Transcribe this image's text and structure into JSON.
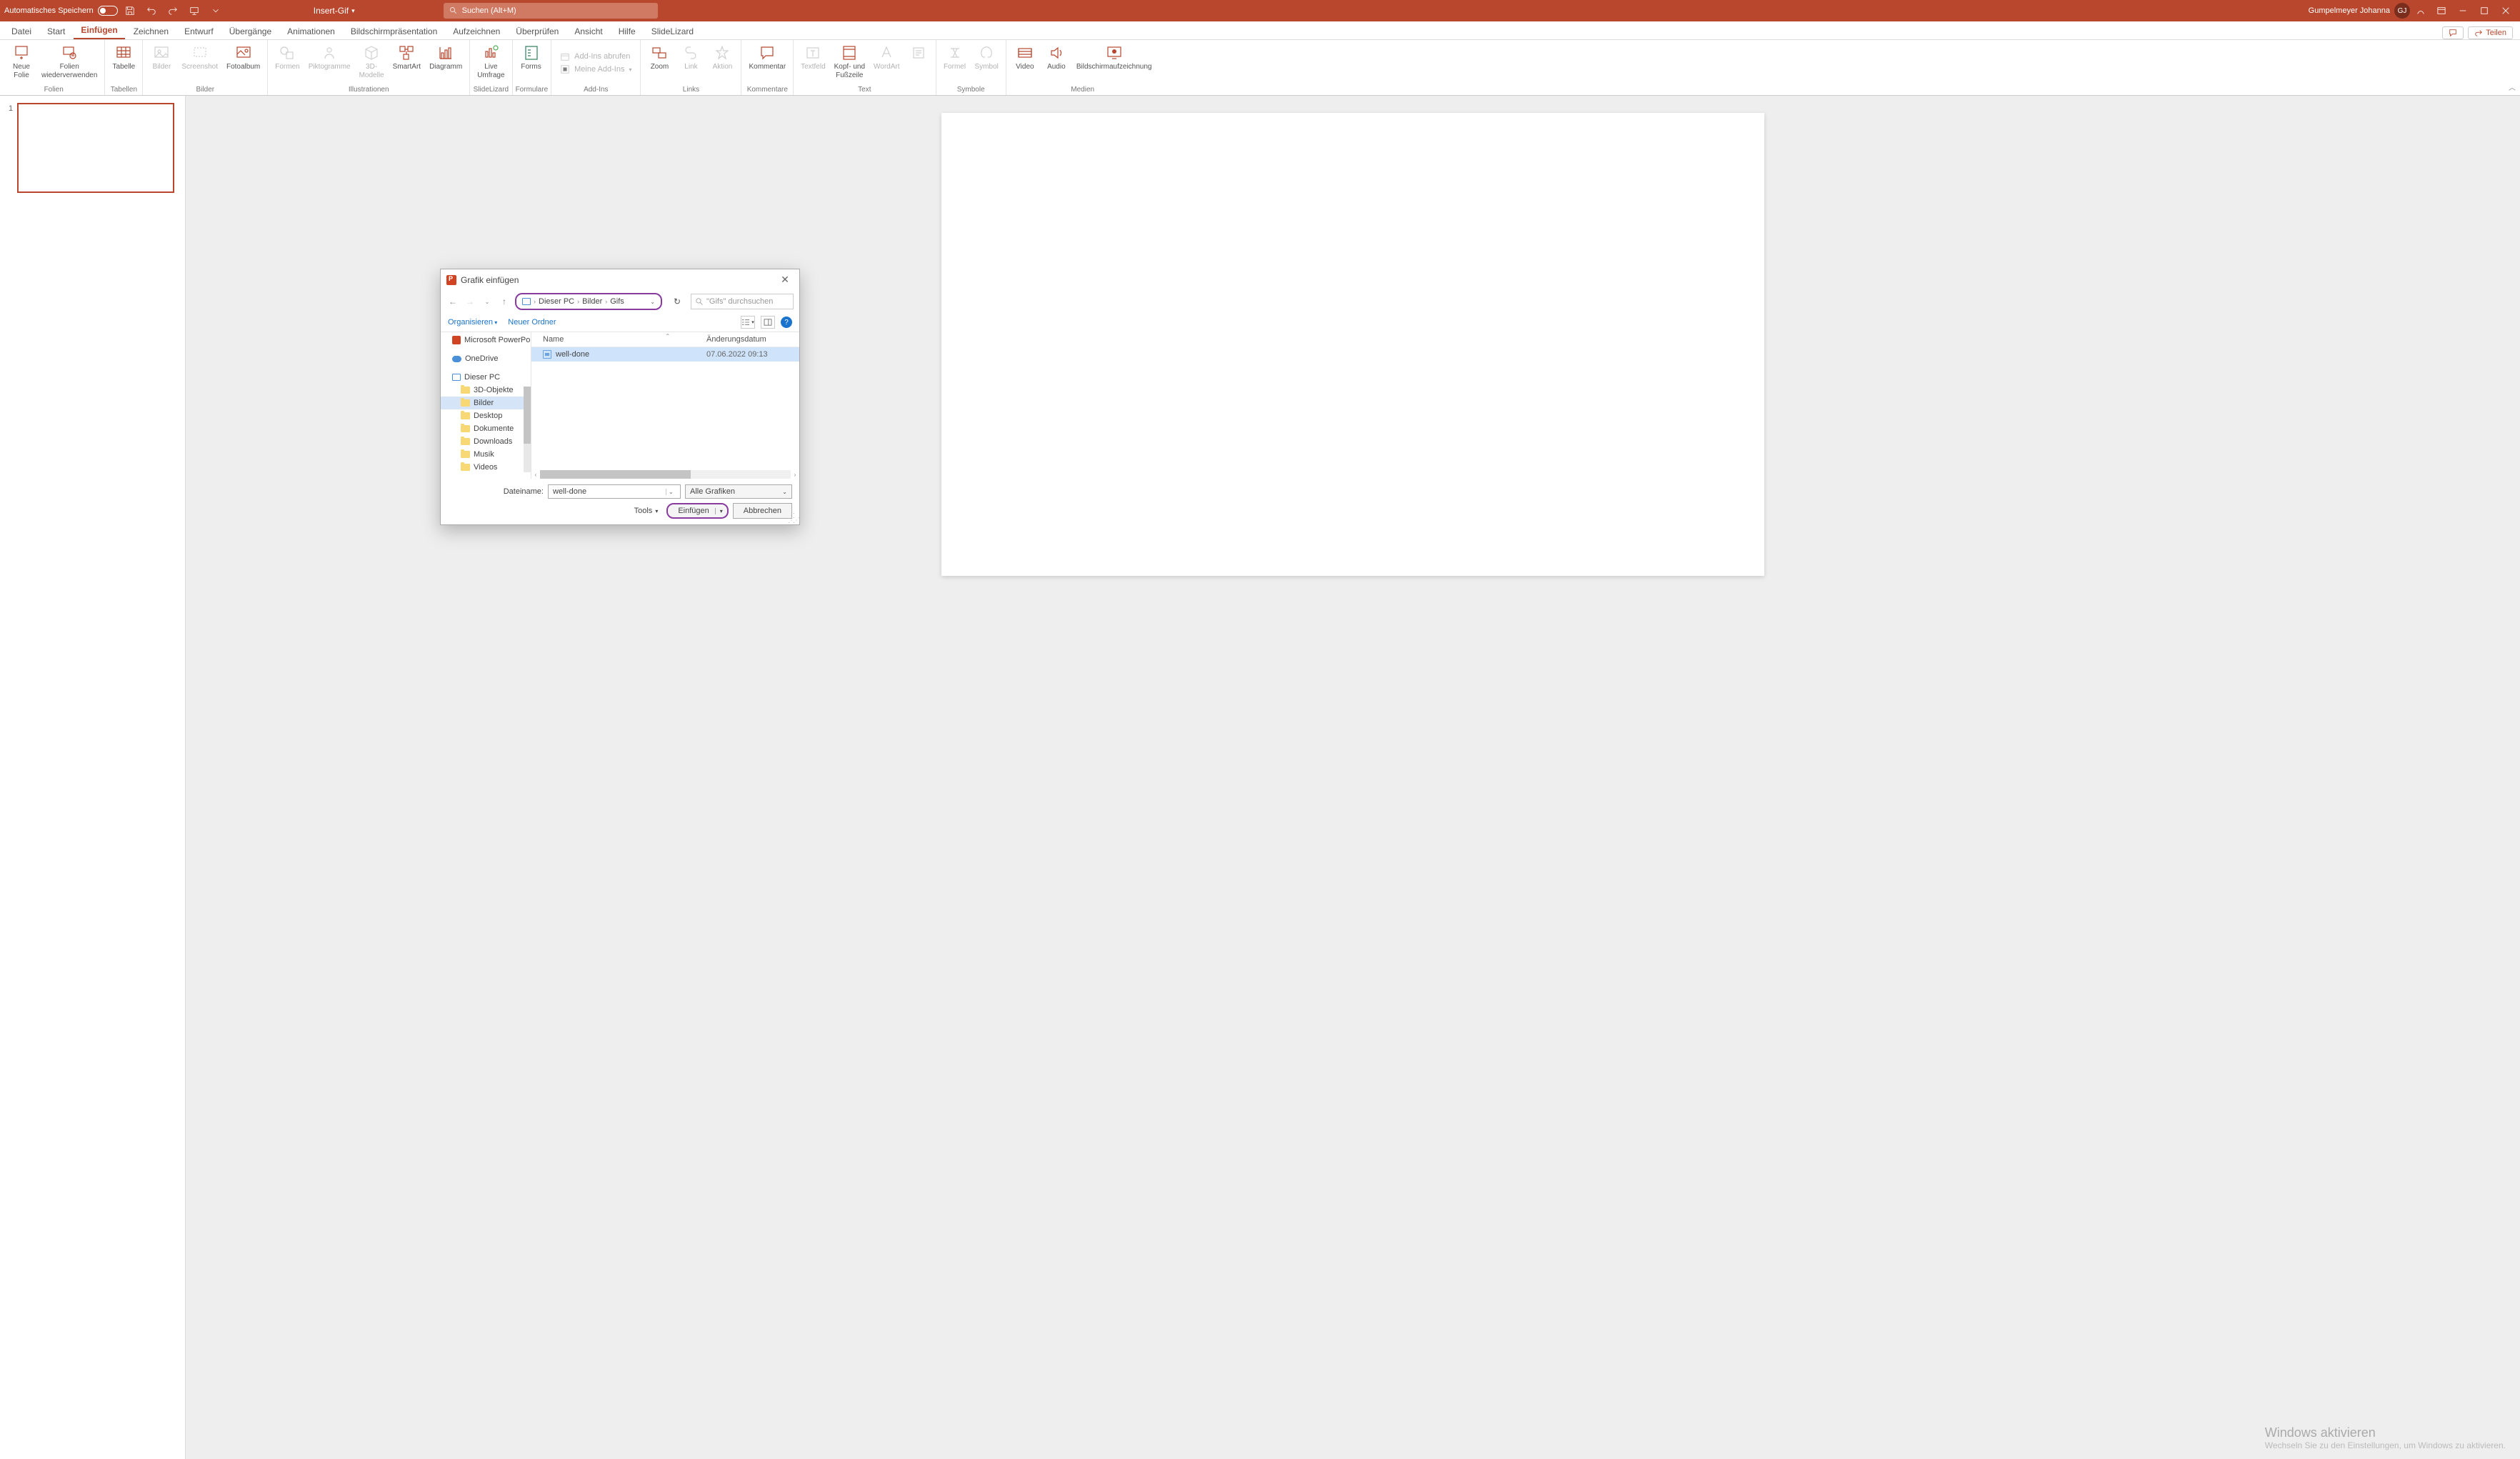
{
  "titleBar": {
    "autoSave": "Automatisches Speichern",
    "documentName": "Insert-Gif",
    "searchPlaceholder": "Suchen (Alt+M)",
    "userName": "Gumpelmeyer Johanna",
    "userInitials": "GJ"
  },
  "ribbonTabs": {
    "datei": "Datei",
    "start": "Start",
    "einfuegen": "Einfügen",
    "zeichnen": "Zeichnen",
    "entwurf": "Entwurf",
    "uebergaenge": "Übergänge",
    "animationen": "Animationen",
    "bildschirm": "Bildschirmpräsentation",
    "aufzeichnen": "Aufzeichnen",
    "ueberpruefen": "Überprüfen",
    "ansicht": "Ansicht",
    "hilfe": "Hilfe",
    "slidelizard": "SlideLizard",
    "teilen": "Teilen"
  },
  "ribbon": {
    "folien": {
      "groupLabel": "Folien",
      "neueFolie": "Neue\nFolie",
      "wiederverwenden": "Folien\nwiederverwenden"
    },
    "tabellen": {
      "groupLabel": "Tabellen",
      "tabelle": "Tabelle"
    },
    "bilder": {
      "groupLabel": "Bilder",
      "bilder": "Bilder",
      "screenshot": "Screenshot",
      "fotoalbum": "Fotoalbum"
    },
    "illustrationen": {
      "groupLabel": "Illustrationen",
      "formen": "Formen",
      "piktogramme": "Piktogramme",
      "dreiD": "3D-\nModelle",
      "smartart": "SmartArt",
      "diagramm": "Diagramm"
    },
    "slidelizard": {
      "groupLabel": "SlideLizard",
      "live": "Live\nUmfrage"
    },
    "formulare": {
      "groupLabel": "Formulare",
      "forms": "Forms"
    },
    "addins": {
      "groupLabel": "Add-Ins",
      "abrufen": "Add-Ins abrufen",
      "meine": "Meine Add-Ins"
    },
    "links": {
      "groupLabel": "Links",
      "zoom": "Zoom",
      "link": "Link",
      "aktion": "Aktion"
    },
    "kommentare": {
      "groupLabel": "Kommentare",
      "kommentar": "Kommentar"
    },
    "text": {
      "groupLabel": "Text",
      "textfeld": "Textfeld",
      "kopfFuss": "Kopf- und\nFußzeile",
      "wordart": "WordArt"
    },
    "symbole": {
      "groupLabel": "Symbole",
      "formel": "Formel",
      "symbol": "Symbol"
    },
    "medien": {
      "groupLabel": "Medien",
      "video": "Video",
      "audio": "Audio",
      "aufzeichnung": "Bildschirmaufzeichnung"
    }
  },
  "slideNum": "1",
  "dialog": {
    "title": "Grafik einfügen",
    "breadcrumb": {
      "pc": "Dieser PC",
      "bilder": "Bilder",
      "gifs": "Gifs"
    },
    "searchPlaceholder": "\"Gifs\" durchsuchen",
    "organisieren": "Organisieren",
    "neuerOrdner": "Neuer Ordner",
    "tree": {
      "ppt": "Microsoft PowerPoint",
      "onedrive": "OneDrive",
      "dieserPC": "Dieser PC",
      "dreiD": "3D-Objekte",
      "bilder": "Bilder",
      "desktop": "Desktop",
      "dokumente": "Dokumente",
      "downloads": "Downloads",
      "musik": "Musik",
      "videos": "Videos"
    },
    "columns": {
      "name": "Name",
      "date": "Änderungsdatum"
    },
    "file": {
      "name": "well-done",
      "date": "07.06.2022 09:13"
    },
    "filenameLabel": "Dateiname:",
    "filenameValue": "well-done",
    "filterLabel": "Alle Grafiken",
    "tools": "Tools",
    "insert": "Einfügen",
    "cancel": "Abbrechen"
  },
  "watermark": {
    "title": "Windows aktivieren",
    "sub": "Wechseln Sie zu den Einstellungen, um Windows zu aktivieren."
  }
}
